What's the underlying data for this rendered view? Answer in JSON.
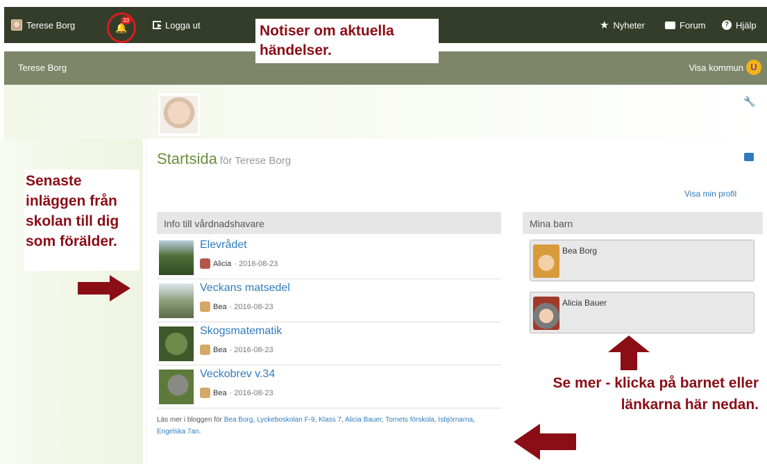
{
  "topbar": {
    "user_name": "Terese Borg",
    "notifications_count": "33",
    "logout_label": "Logga ut",
    "news_label": "Nyheter",
    "forum_label": "Forum",
    "help_label": "Hjälp"
  },
  "subbar": {
    "title": "Terese Borg",
    "show_municipality": "Visa kommun",
    "logo_letter": "U"
  },
  "page": {
    "title": "Startsida",
    "for_text": "för Terese Borg",
    "show_profile_link": "Visa min profil"
  },
  "info": {
    "header": "Info till vårdnadshavare",
    "posts": [
      {
        "title": "Elevrådet",
        "author": "Alicia",
        "date": "· 2016-08-23"
      },
      {
        "title": "Veckans matsedel",
        "author": "Bea",
        "date": "· 2016-08-23"
      },
      {
        "title": "Skogsmatematik",
        "author": "Bea",
        "date": "· 2016-08-23"
      },
      {
        "title": "Veckobrev v.34",
        "author": "Bea",
        "date": "· 2016-08-23"
      }
    ],
    "read_more_prefix": "Läs mer i bloggen för",
    "read_more_links": [
      "Bea Borg",
      "Lyckeboskolan F-9",
      "Klass 7",
      "Alicia Bauer",
      "Tornets förskola",
      "Isbjörnarna",
      "Engelska 7an"
    ]
  },
  "children": {
    "header": "Mina barn",
    "items": [
      {
        "name": "Bea Borg"
      },
      {
        "name": "Alicia Bauer"
      }
    ]
  },
  "annotations": {
    "top": "Notiser om aktuella händelser.",
    "left": "Senaste inläggen från skolan till dig som förälder.",
    "bottom": "Se mer - klicka på barnet eller länkarna här nedan."
  },
  "colors": {
    "topbar_bg": "#343d2a",
    "subbar_bg": "#7e8669",
    "link": "#2f7bbd",
    "title_green": "#6b8e3d",
    "annotation_red": "#8b0d16"
  }
}
